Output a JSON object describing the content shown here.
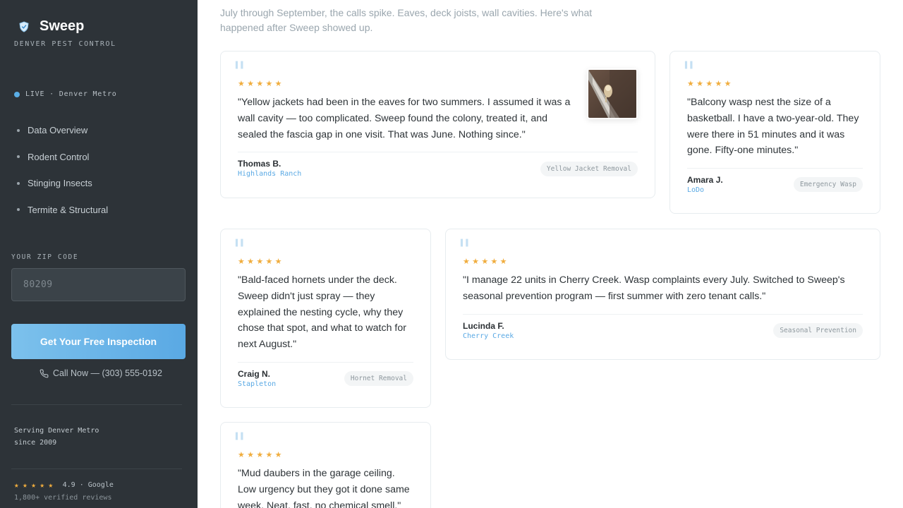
{
  "sidebar": {
    "brand": "Sweep",
    "brand_sub": "DENVER PEST CONTROL",
    "live": "LIVE · Denver Metro",
    "nav": [
      "Data Overview",
      "Rodent Control",
      "Stinging Insects",
      "Termite & Structural"
    ],
    "zip_label": "YOUR ZIP CODE",
    "zip_placeholder": "80209",
    "cta_label": "Get Your Free Inspection",
    "call_label": "Call Now — (303) 555-0192",
    "serving_line1": "Serving Denver Metro",
    "serving_line2": "since 2009",
    "rating_stars": "★★★★★",
    "rating_text": "4.9 · Google",
    "reviews_count": "1,800+ verified reviews"
  },
  "main": {
    "intro": "July through September, the calls spike. Eaves, deck joists, wall cavities. Here's what happened after Sweep showed up."
  },
  "testimonials": [
    {
      "stars": "★★★★★",
      "quote": "\"Yellow jackets had been in the eaves for two summers. I assumed it was a wall cavity — too complicated. Sweep found the colony, treated it, and sealed the fascia gap in one visit. That was June. Nothing since.\"",
      "author": "Thomas B.",
      "location": "Highlands Ranch",
      "tag": "Yellow Jacket Removal"
    },
    {
      "stars": "★★★★★",
      "quote": "\"Balcony wasp nest the size of a basketball. I have a two-year-old. They were there in 51 minutes and it was gone. Fifty-one minutes.\"",
      "author": "Amara J.",
      "location": "LoDo",
      "tag": "Emergency Wasp"
    },
    {
      "stars": "★★★★★",
      "quote": "\"Bald-faced hornets under the deck. Sweep didn't just spray — they explained the nesting cycle, why they chose that spot, and what to watch for next August.\"",
      "author": "Craig N.",
      "location": "Stapleton",
      "tag": "Hornet Removal"
    },
    {
      "stars": "★★★★★",
      "quote": "\"I manage 22 units in Cherry Creek. Wasp complaints every July. Switched to Sweep's seasonal prevention program — first summer with zero tenant calls.\"",
      "author": "Lucinda F.",
      "location": "Cherry Creek",
      "tag": "Seasonal Prevention"
    },
    {
      "stars": "★★★★★",
      "quote": "\"Mud daubers in the garage ceiling. Low urgency but they got it done same week. Neat, fast, no chemical smell.\""
    }
  ],
  "colors": {
    "sidebar_bg": "#2d3338",
    "accent": "#5aa9e4",
    "star": "#f0ad3e"
  },
  "icons": [
    "shield-icon",
    "live-dot-icon",
    "phone-icon",
    "quote-icon",
    "star-icon"
  ]
}
